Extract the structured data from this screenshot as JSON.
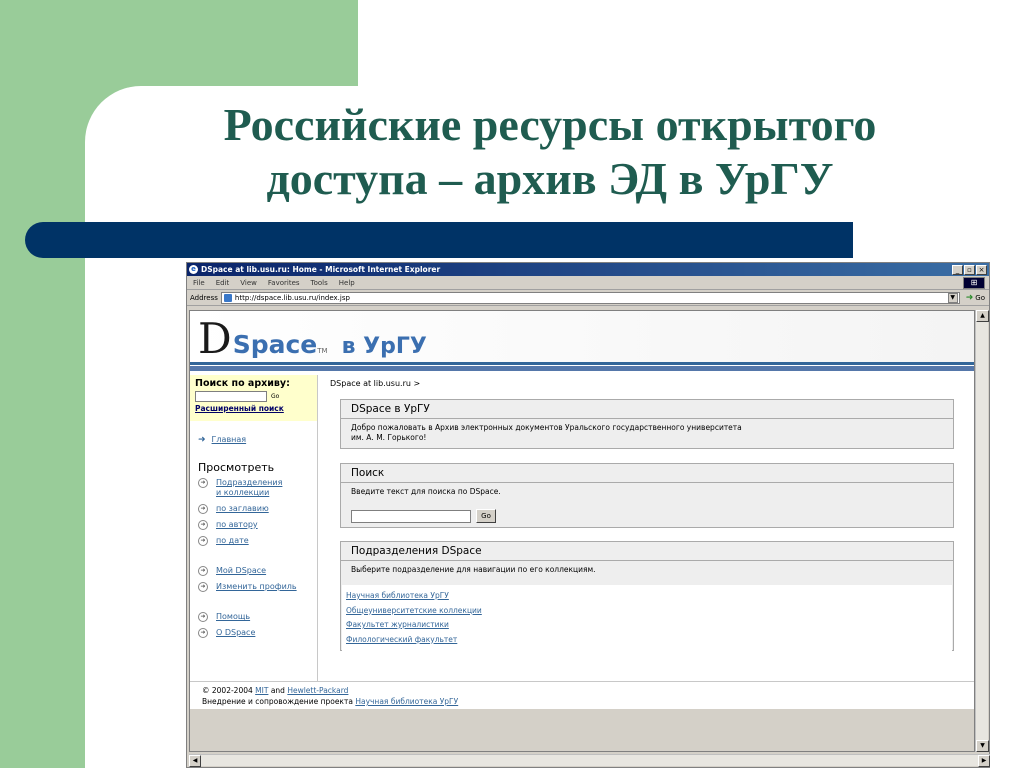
{
  "slide": {
    "title_line1": "Российские ресурсы открытого",
    "title_line2": "доступа – архив ЭД в УрГУ",
    "colors": {
      "green": "#99cc99",
      "navy": "#003366",
      "title": "#1f5c50"
    }
  },
  "browser": {
    "window_title": "DSpace at lib.usu.ru: Home - Microsoft Internet Explorer",
    "menu": [
      "File",
      "Edit",
      "View",
      "Favorites",
      "Tools",
      "Help"
    ],
    "address_label": "Address",
    "address_url": "http://dspace.lib.usu.ru/index.jsp",
    "go_label": "Go"
  },
  "dspace": {
    "logo_d": "D",
    "logo_space": "Space",
    "logo_tm": "TM",
    "logo_urgu": "в УрГУ",
    "sidebar": {
      "search_label": "Поиск по архиву:",
      "search_go": "Go",
      "advanced_search": "Расширенный поиск",
      "home": "Главная",
      "browse_title": "Просмотреть",
      "browse_items": [
        {
          "line1": "Подразделения",
          "line2": "и коллекции"
        },
        {
          "line1": "по заглавию",
          "line2": ""
        },
        {
          "line1": "по автору",
          "line2": ""
        },
        {
          "line1": "по дате",
          "line2": ""
        }
      ],
      "user_items": [
        "Мой DSpace",
        "Изменить профиль"
      ],
      "help_items": [
        "Помощь",
        "О DSpace"
      ]
    },
    "breadcrumb": "DSpace at lib.usu.ru >",
    "welcome_panel": {
      "title": "DSpace в УрГУ",
      "text_line1": "Добро пожаловать в Архив электронных документов Уральского государственного университета",
      "text_line2": "им. А. М. Горького!"
    },
    "search_panel": {
      "title": "Поиск",
      "text": "Введите текст для поиска по DSpace.",
      "go": "Go"
    },
    "communities_panel": {
      "title": "Подразделения DSpace",
      "text": "Выберите подразделение для навигации по его коллекциям.",
      "items": [
        "Научная библиотека УрГУ",
        "Общеуниверситетские коллекции",
        "Факультет журналистики",
        "Филологический факультет"
      ]
    },
    "footer": {
      "copyright_prefix": "© 2002-2004",
      "mit": "MIT",
      "and": "and",
      "hp": "Hewlett-Packard",
      "support_prefix": "Внедрение и сопровождение проекта",
      "support_link": "Научная библиотека УрГУ"
    }
  }
}
